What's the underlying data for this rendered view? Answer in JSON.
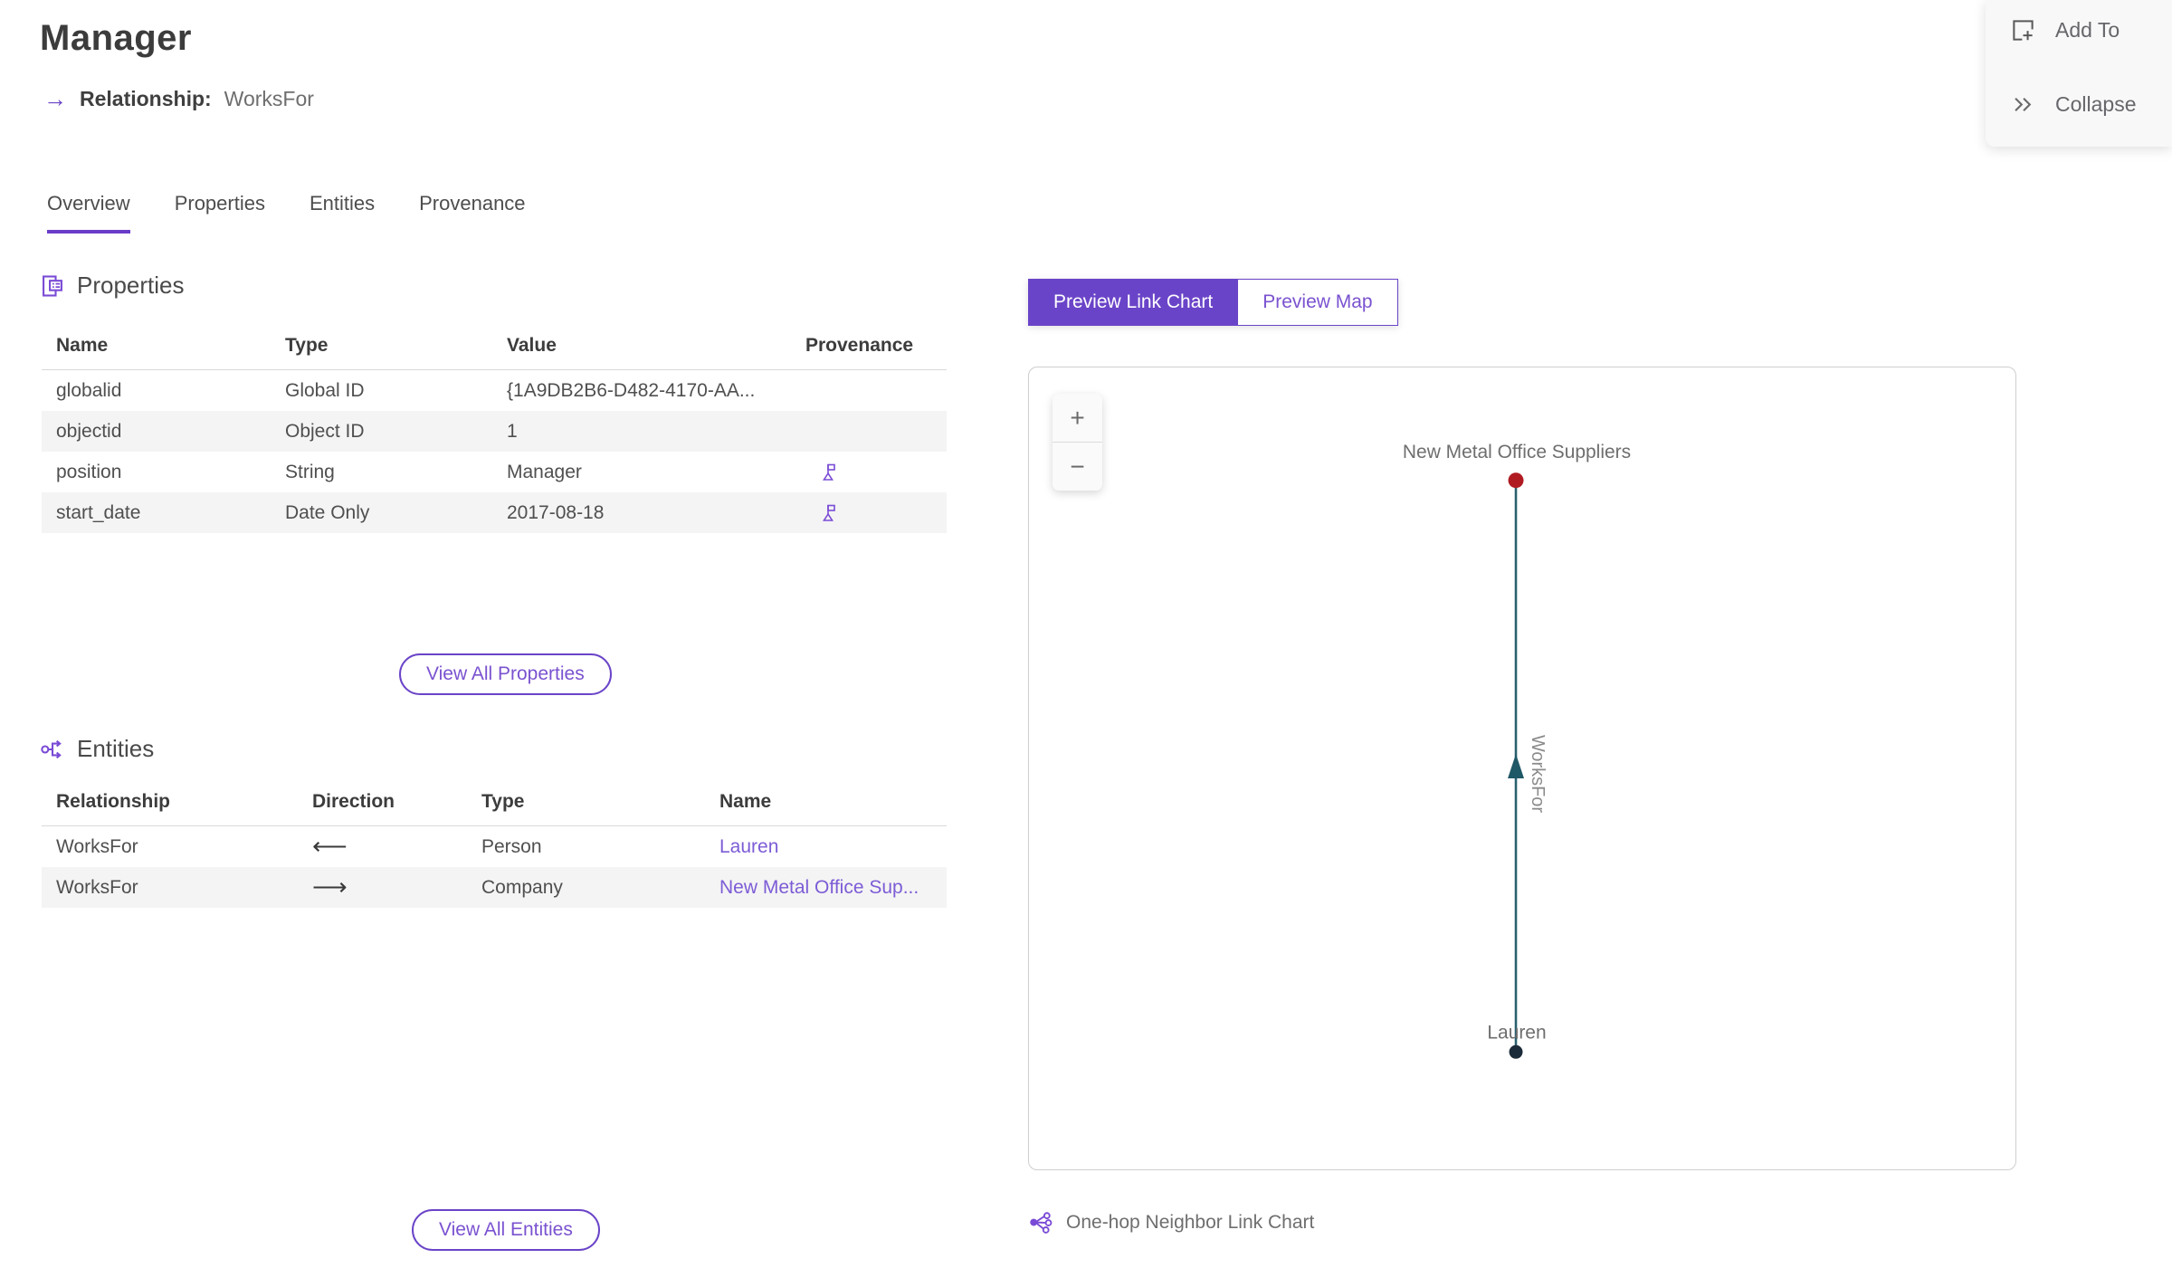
{
  "header": {
    "title": "Manager",
    "relationship_icon": "→",
    "subtitle_label": "Relationship:",
    "subtitle_value": "WorksFor"
  },
  "actions": {
    "add_to_label": "Add To",
    "collapse_label": "Collapse"
  },
  "tabs": [
    {
      "label": "Overview",
      "active": true
    },
    {
      "label": "Properties",
      "active": false
    },
    {
      "label": "Entities",
      "active": false
    },
    {
      "label": "Provenance",
      "active": false
    }
  ],
  "properties_section": {
    "title": "Properties",
    "columns": {
      "name": "Name",
      "type": "Type",
      "value": "Value",
      "provenance": "Provenance"
    },
    "rows": [
      {
        "name": "globalid",
        "type": "Global ID",
        "value": "{1A9DB2B6-D482-4170-AA...",
        "has_provenance_flag": false
      },
      {
        "name": "objectid",
        "type": "Object ID",
        "value": "1",
        "has_provenance_flag": false
      },
      {
        "name": "position",
        "type": "String",
        "value": "Manager",
        "has_provenance_flag": true
      },
      {
        "name": "start_date",
        "type": "Date Only",
        "value": "2017-08-18",
        "has_provenance_flag": true
      }
    ],
    "view_all_label": "View All Properties"
  },
  "entities_section": {
    "title": "Entities",
    "columns": {
      "relationship": "Relationship",
      "direction": "Direction",
      "type": "Type",
      "name": "Name"
    },
    "rows": [
      {
        "relationship": "WorksFor",
        "direction": "incoming",
        "direction_glyph": "⟵",
        "type": "Person",
        "name": "Lauren"
      },
      {
        "relationship": "WorksFor",
        "direction": "outgoing",
        "direction_glyph": "⟶",
        "type": "Company",
        "name": "New Metal Office Sup..."
      }
    ],
    "view_all_label": "View All Entities"
  },
  "preview": {
    "link_chart_tab": "Preview Link Chart",
    "map_tab": "Preview Map",
    "zoom_in_glyph": "+",
    "zoom_out_glyph": "−",
    "caption": "One-hop Neighbor Link Chart"
  },
  "link_chart": {
    "nodes": [
      {
        "label": "New Metal Office Suppliers",
        "color": "#b01b22",
        "position": "top"
      },
      {
        "label": "Lauren",
        "color": "#1c2b39",
        "position": "bottom"
      }
    ],
    "edge": {
      "label": "WorksFor",
      "color": "#2a606e",
      "arrow_direction": "up"
    }
  },
  "colors": {
    "accent_purple": "#6a44c8",
    "link_purple": "#7c5cd6",
    "tab_underline": "#6a3dc8",
    "node_top_red": "#b01b22",
    "node_bottom_navy": "#1c2b39",
    "edge_teal": "#2a606e",
    "row_alt_bg": "#f4f4f4",
    "panel_bg": "#f8f8f8"
  }
}
